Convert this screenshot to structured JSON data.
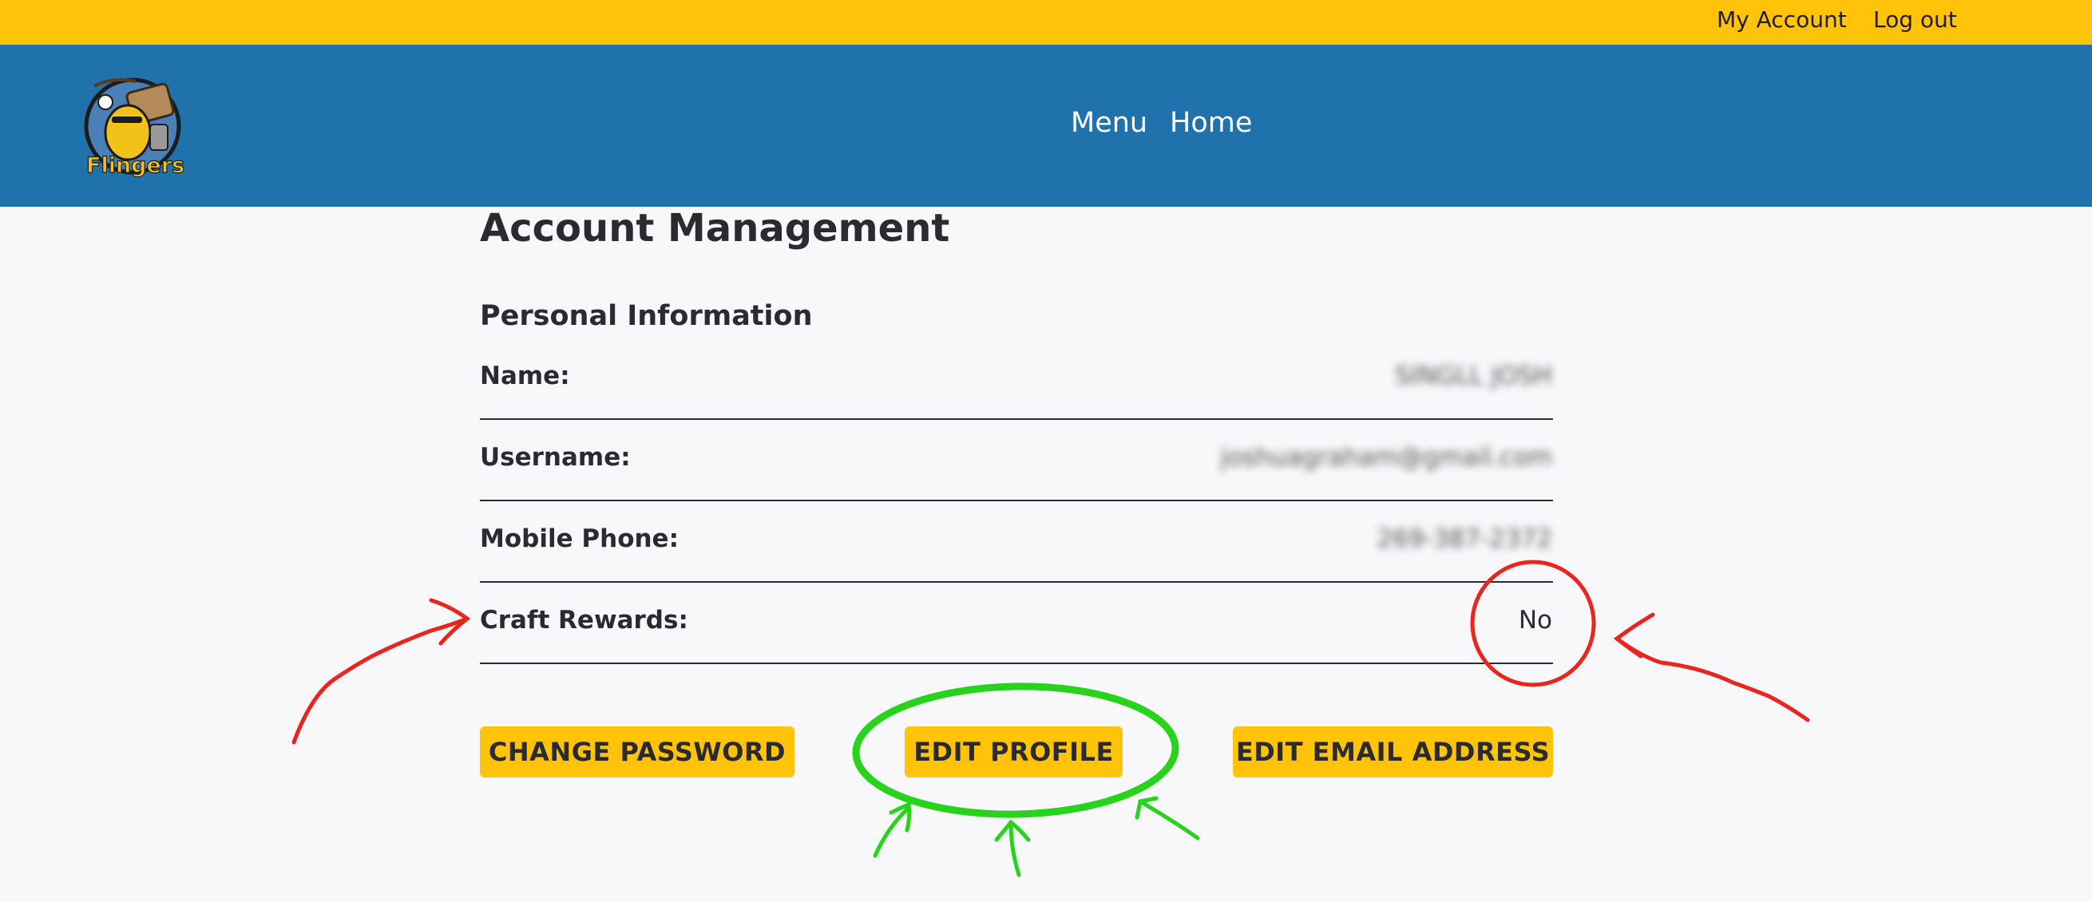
{
  "topbar": {
    "my_account": "My Account",
    "log_out": "Log out"
  },
  "navbar": {
    "logo_text": "Flingers",
    "menu": "Menu",
    "home": "Home"
  },
  "page": {
    "title": "Account Management",
    "section_title": "Personal Information"
  },
  "fields": [
    {
      "label": "Name:",
      "value": "SINGLL JOSH"
    },
    {
      "label": "Username:",
      "value": "joshuagraham@gmail.com"
    },
    {
      "label": "Mobile Phone:",
      "value": "269-387-2372"
    },
    {
      "label": "Craft Rewards:",
      "value": "No"
    }
  ],
  "buttons": {
    "change_password": "CHANGE PASSWORD",
    "edit_profile": "EDIT PROFILE",
    "edit_email": "EDIT EMAIL ADDRESS"
  },
  "colors": {
    "topbar": "#ffc40a",
    "navbar": "#1f72ac",
    "annotation_red": "#e8261c",
    "annotation_green": "#27d31b"
  }
}
